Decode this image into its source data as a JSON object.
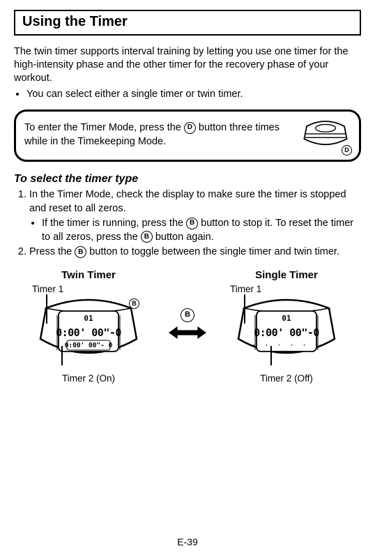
{
  "title": "Using the Timer",
  "intro": "The twin timer supports interval training by letting you use one timer for the high-intensity phase and the other timer for the recovery phase of your workout.",
  "bullet1": "You can select either a single timer or twin timer.",
  "modeTip": {
    "pre": "To enter the Timer Mode, press the ",
    "btn": "D",
    "post": " button three times while in the Timekeeping Mode."
  },
  "subhead": "To select the timer type",
  "step1": "In the Timer Mode, check the display to make sure the timer is stopped and reset to all zeros.",
  "step1a": {
    "pre": "If the timer is running, press the ",
    "b1": "B",
    "mid": " button to stop it. To reset the timer to all zeros, press the ",
    "b2": "B",
    "post": " button again."
  },
  "step2": {
    "pre": "Press the ",
    "b": "B",
    "post": " button to toggle between the single timer and twin timer."
  },
  "fig": {
    "leftTitle": "Twin Timer",
    "rightTitle": "Single Timer",
    "timer1": "Timer 1",
    "timer2on": "Timer 2 (On)",
    "timer2off": "Timer 2 (Off)",
    "arrowBtn": "B",
    "bBadge": "B",
    "dBadge": "D",
    "lcdTop": "01",
    "lcdMain": "0:00' 00\"-0",
    "lcdSub": "0:00' 00\"- 0"
  },
  "pageNum": "E-39"
}
